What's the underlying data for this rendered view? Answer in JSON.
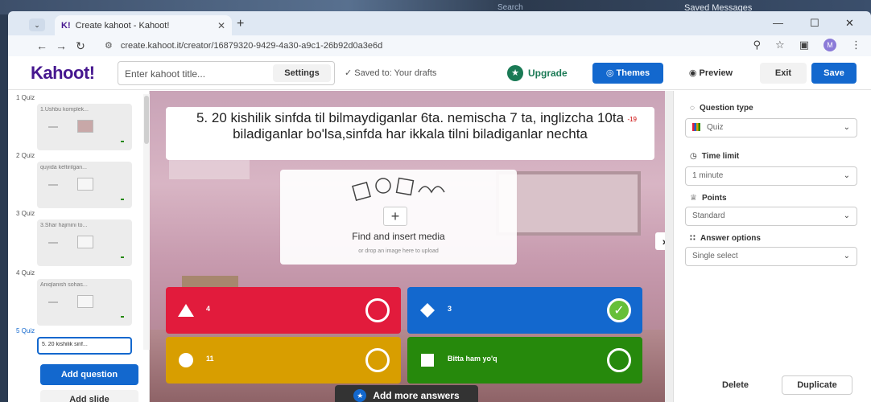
{
  "taskbar": {
    "search_label": "Search",
    "telegram_title": "Saved Messages"
  },
  "browser": {
    "tab_title": "Create kahoot - Kahoot!",
    "tab_favicon": "K!",
    "url": "create.kahoot.it/creator/16879320-9429-4a30-a9c1-26b92d0a3e6d",
    "profile_initial": "M"
  },
  "header": {
    "logo": "Kahoot!",
    "title_placeholder": "Enter kahoot title...",
    "settings_label": "Settings",
    "saved_status": "Saved to: Your drafts",
    "upgrade_label": "Upgrade",
    "themes_label": "Themes",
    "preview_label": "Preview",
    "exit_label": "Exit",
    "save_label": "Save"
  },
  "sidebar": {
    "slides": [
      {
        "label": "1  Quiz",
        "text": "1.Ushbu komplek..."
      },
      {
        "label": "2  Quiz",
        "text": "quyida keltirilgan..."
      },
      {
        "label": "3  Quiz",
        "text": "3.Shar hajmini to..."
      },
      {
        "label": "4  Quiz",
        "text": "Aniqlanish sohas..."
      },
      {
        "label": "5  Quiz",
        "text": "5. 20 kishilik sinf..."
      }
    ],
    "add_question_label": "Add question",
    "add_slide_label": "Add slide"
  },
  "editor": {
    "question": "5. 20 kishilik sinfda til bilmaydiganlar 6ta. nemischa 7 ta, inglizcha 10ta biladiganlar bo'lsa,sinfda har ikkala tilni biladiganlar nechta",
    "char_count": "-19",
    "media_label": "Find and insert media",
    "media_hint": "or drop an image here to upload",
    "answers": [
      {
        "text": "4",
        "color": "#e21b3c",
        "shape": "triangle-icon",
        "correct": false
      },
      {
        "text": "3",
        "color": "#1368ce",
        "shape": "diamond-icon",
        "correct": true
      },
      {
        "text": "11",
        "color": "#d89e00",
        "shape": "circle-icon",
        "correct": false
      },
      {
        "text": "Bitta ham yo'q",
        "color": "#26890c",
        "shape": "square-icon",
        "correct": false
      }
    ],
    "add_more_label": "Add more answers"
  },
  "settings_panel": {
    "question_type_label": "Question type",
    "question_type_value": "Quiz",
    "time_limit_label": "Time limit",
    "time_limit_value": "1 minute",
    "points_label": "Points",
    "points_value": "Standard",
    "answer_options_label": "Answer options",
    "answer_options_value": "Single select",
    "delete_label": "Delete",
    "duplicate_label": "Duplicate"
  }
}
